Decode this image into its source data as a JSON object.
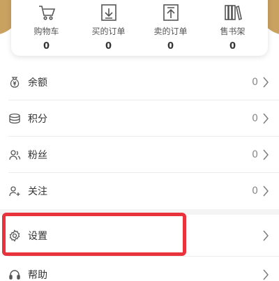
{
  "stats": [
    {
      "label": "购物车",
      "value": "0",
      "icon": "shopping-cart-icon"
    },
    {
      "label": "买的订单",
      "value": "0",
      "icon": "download-order-icon"
    },
    {
      "label": "卖的订单",
      "value": "0",
      "icon": "upload-order-icon"
    },
    {
      "label": "售书架",
      "value": "0",
      "icon": "bookshelf-icon"
    }
  ],
  "menu": {
    "balance": {
      "label": "余额",
      "value": "0",
      "icon": "money-bag-icon"
    },
    "points": {
      "label": "积分",
      "value": "0",
      "icon": "coins-icon"
    },
    "fans": {
      "label": "粉丝",
      "value": "0",
      "icon": "fans-icon"
    },
    "follow": {
      "label": "关注",
      "value": "0",
      "icon": "follow-user-icon"
    },
    "settings": {
      "label": "设置",
      "icon": "gear-icon"
    },
    "help": {
      "label": "帮助",
      "icon": "help-headset-icon"
    }
  },
  "colors": {
    "accent": "#c9a160",
    "highlight": "#e8323c",
    "icon": "#555555"
  }
}
